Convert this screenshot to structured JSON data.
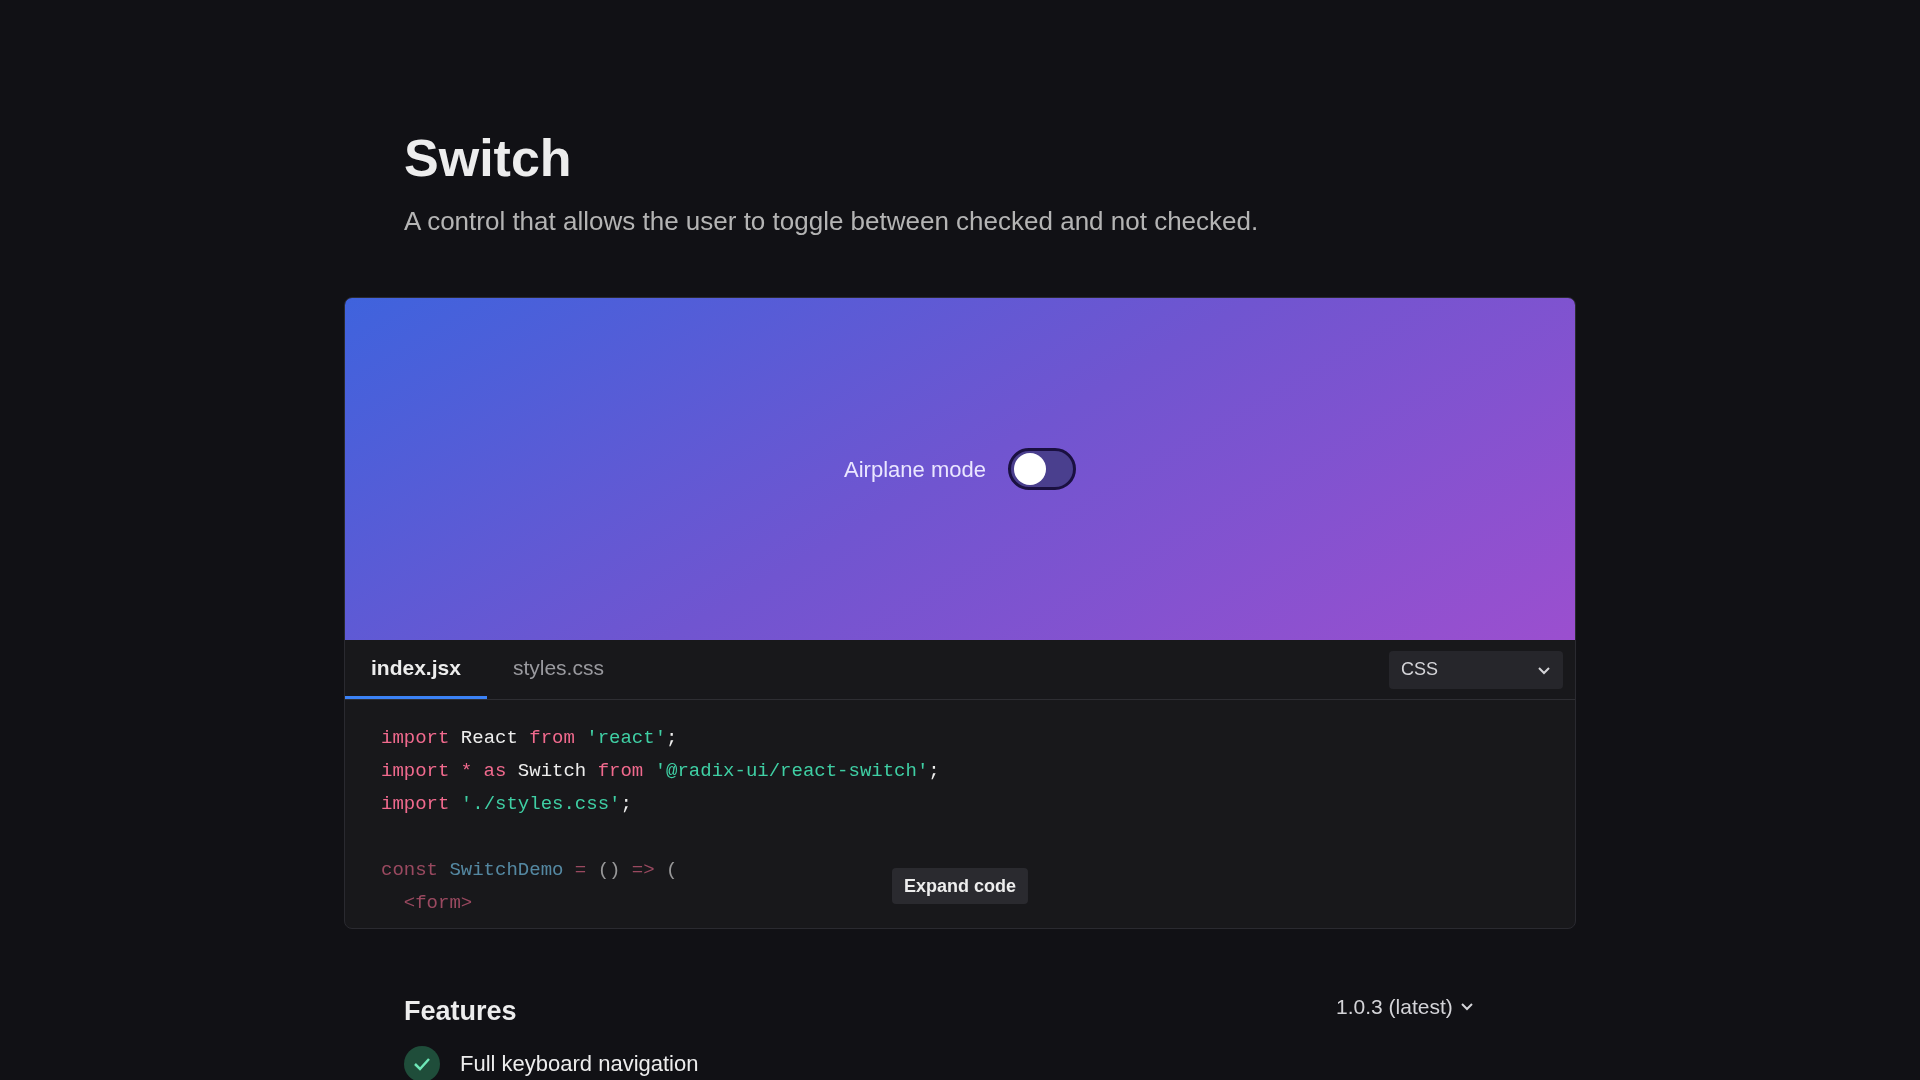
{
  "header": {
    "title": "Switch",
    "description": "A control that allows the user to toggle between checked and not checked."
  },
  "preview": {
    "label": "Airplane mode",
    "switch": {
      "checked": false
    }
  },
  "code_panel": {
    "tabs": [
      {
        "label": "index.jsx",
        "selected": true
      },
      {
        "label": "styles.css",
        "selected": false
      }
    ],
    "style_select": {
      "value": "CSS"
    },
    "code_blocks": [
      {
        "lines": [
          {
            "tokens": [
              {
                "kind": "keyword",
                "text": "import"
              },
              {
                "kind": "plain",
                "text": " React "
              },
              {
                "kind": "keyword",
                "text": "from"
              },
              {
                "kind": "string",
                "text": " 'react'"
              },
              {
                "kind": "plain",
                "text": ";"
              }
            ]
          },
          {
            "tokens": [
              {
                "kind": "keyword",
                "text": "import *"
              },
              {
                "kind": "keyword",
                "text": " as"
              },
              {
                "kind": "plain",
                "text": " Switch "
              },
              {
                "kind": "keyword",
                "text": "from"
              },
              {
                "kind": "string",
                "text": " '@radix-ui/react-switch'"
              },
              {
                "kind": "plain",
                "text": ";"
              }
            ]
          },
          {
            "tokens": [
              {
                "kind": "keyword",
                "text": "import"
              },
              {
                "kind": "string",
                "text": " './styles.css'"
              },
              {
                "kind": "plain",
                "text": ";"
              }
            ]
          }
        ]
      },
      {
        "lines": [
          {
            "tokens": [
              {
                "kind": "keyword",
                "text": "const"
              },
              {
                "kind": "name",
                "text": " SwitchDemo"
              },
              {
                "kind": "keyword",
                "text": " ="
              },
              {
                "kind": "plain",
                "text": " ()"
              },
              {
                "kind": "keyword",
                "text": " =>"
              },
              {
                "kind": "plain",
                "text": " ("
              }
            ]
          },
          {
            "tokens": [
              {
                "kind": "keyword",
                "text": "  <form>"
              }
            ]
          }
        ]
      }
    ],
    "expand_button": "Expand code"
  },
  "features": {
    "title": "Features",
    "version": "1.0.3 (latest)",
    "items": [
      {
        "label": "Full keyboard navigation"
      }
    ]
  }
}
